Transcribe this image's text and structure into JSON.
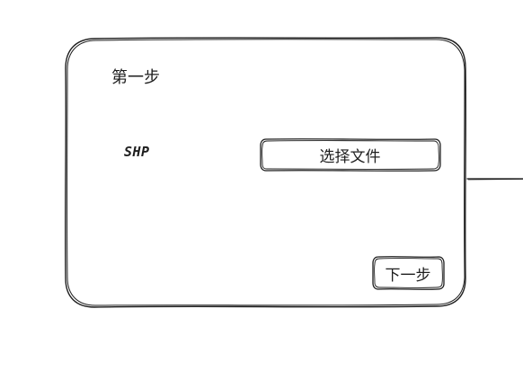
{
  "dialog": {
    "step_title": "第一步",
    "file_row": {
      "label": "SHP",
      "choose_file_label": "选择文件"
    },
    "next_button_label": "下一步"
  }
}
